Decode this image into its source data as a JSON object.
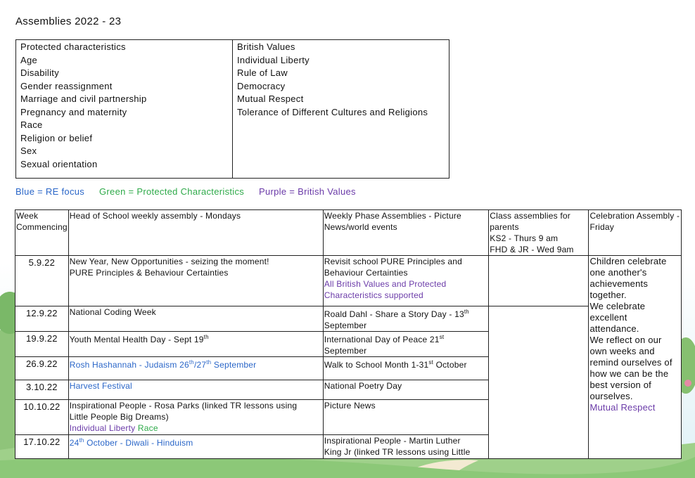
{
  "title": "Assemblies 2022 - 23",
  "colors": {
    "blue": "#2a66c8",
    "green": "#2faa4a",
    "purple": "#6a3aa8"
  },
  "protected": {
    "heading": "Protected characteristics",
    "items": [
      "Age",
      "Disability",
      "Gender reassignment",
      "Marriage and civil partnership",
      "Pregnancy and maternity",
      "Race",
      "Religion or belief",
      "Sex",
      "Sexual orientation"
    ]
  },
  "british": {
    "heading": "British Values",
    "items": [
      "Individual Liberty",
      "Rule of Law",
      "Democracy",
      "Mutual Respect",
      "Tolerance of Different Cultures and Religions"
    ]
  },
  "legend": {
    "blue": "Blue = RE focus",
    "green": "Green = Protected Characteristics",
    "purple": "Purple = British Values"
  },
  "table": {
    "headers": {
      "week_1": "Week",
      "week_2": "Commencing",
      "hos": "Head of School weekly assembly - Mondays",
      "phase_1": "Weekly Phase Assemblies - Picture",
      "phase_2": "News/world events",
      "class_1": "Class assemblies for",
      "class_2": "parents",
      "class_3": "KS2 - Thurs 9 am",
      "class_4": "FHD & JR - Wed 9am",
      "cel_1": "Celebration Assembly -",
      "cel_2": "Friday"
    },
    "rows": [
      {
        "week": "5.9.22",
        "hos_1": "New Year, New Opportunities - seizing the moment!",
        "hos_2": "PURE Principles & Behaviour Certainties",
        "phase_1": "Revisit school PURE Principles and",
        "phase_2": "Behaviour Certainties",
        "phase_3": "All British Values and Protected",
        "phase_4": "Characteristics supported"
      },
      {
        "week": "12.9.22",
        "hos_1": "National Coding Week",
        "phase_1": "Roald Dahl - Share a Story Day - 13",
        "phase_sup": "th",
        "phase_2": "September"
      },
      {
        "week": "19.9.22",
        "hos_1": "Youth Mental Health Day - Sept 19",
        "hos_sup": "th",
        "phase_1": "International Day of Peace 21",
        "phase_sup": "st",
        "phase_2": "September"
      },
      {
        "week": "26.9.22",
        "hos_1": "Rosh Hashannah - Judaism 26",
        "hos_sup": "th",
        "hos_mid": "/27",
        "hos_sup2": "th",
        "hos_end": " September",
        "phase_1": "Walk to School Month 1-31",
        "phase_sup": "st",
        "phase_end": " October"
      },
      {
        "week": "3.10.22",
        "hos_1": "Harvest Festival",
        "phase_1": "National Poetry Day"
      },
      {
        "week": "10.10.22",
        "hos_1": "Inspirational People - Rosa Parks (linked TR lessons using",
        "hos_2": "Little People Big Dreams)",
        "hos_3a": "Individual Liberty",
        "hos_3b": "Race",
        "phase_1": "Picture News"
      },
      {
        "week": "17.10.22",
        "hos_sup_pre": "24",
        "hos_sup": "th",
        "hos_1": " October - Diwali - Hinduism",
        "phase_1": "Inspirational People -  Martin Luther",
        "phase_2": "King Jr (linked TR lessons using Little"
      }
    ],
    "celebration": {
      "lines": [
        "Children celebrate",
        "one another's",
        "achievements",
        "together.",
        "We celebrate",
        "excellent",
        "attendance.",
        "We reflect on our",
        "own weeks and",
        "remind ourselves of",
        "how we can be the",
        "best version of",
        "ourselves."
      ],
      "value": "Mutual Respect"
    }
  }
}
